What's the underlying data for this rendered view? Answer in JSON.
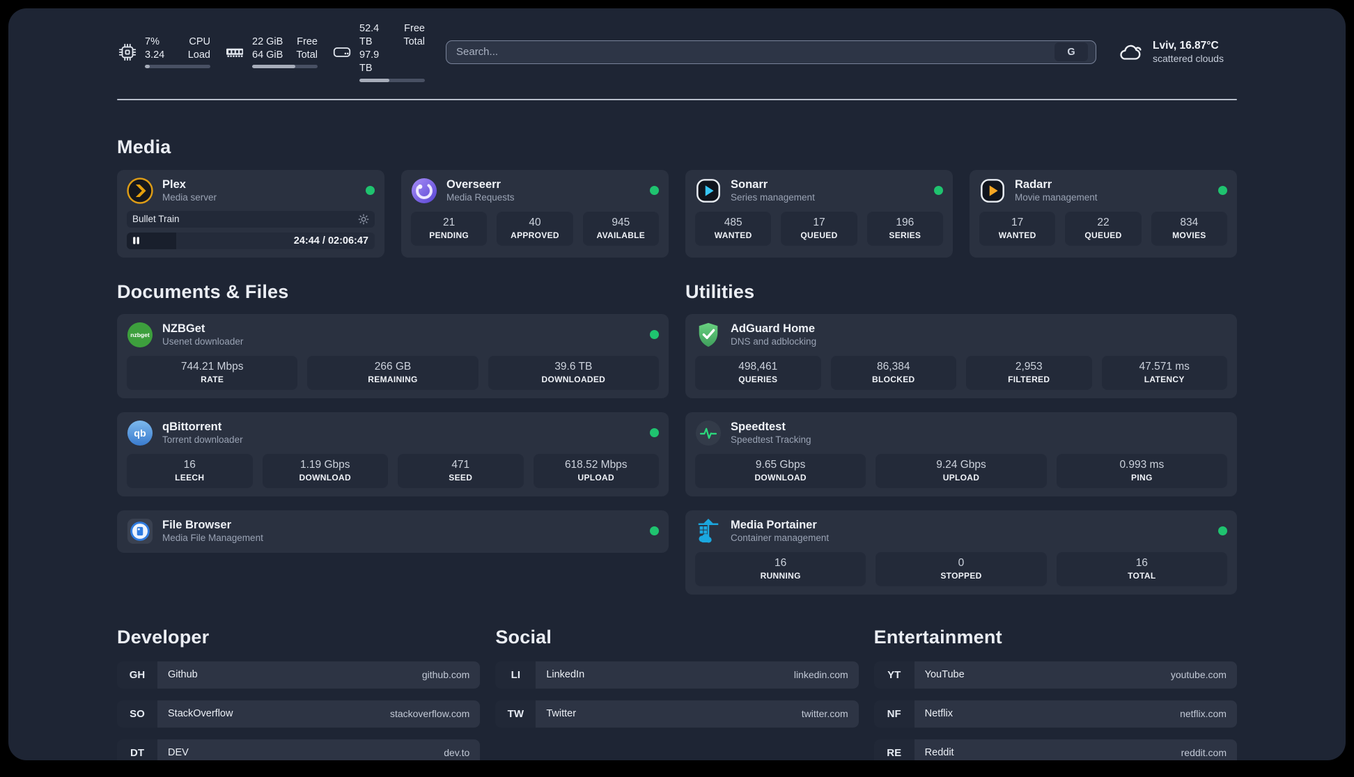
{
  "topbar": {
    "cpu": {
      "value_line1": "7%",
      "value_line2": "3.24",
      "label_line1": "CPU",
      "label_line2": "Load",
      "progress_percent": 7
    },
    "memory": {
      "value_line1": "22 GiB",
      "value_line2": "64 GiB",
      "label_line1": "Free",
      "label_line2": "Total",
      "progress_percent": 66
    },
    "disk": {
      "value_line1": "52.4 TB",
      "value_line2": "97.9 TB",
      "label_line1": "Free",
      "label_line2": "Total",
      "progress_percent": 46
    },
    "search": {
      "placeholder": "Search...",
      "key_label": "G"
    },
    "weather": {
      "location_temp": "Lviv, 16.87°C",
      "condition": "scattered clouds"
    }
  },
  "media": {
    "title": "Media",
    "plex": {
      "title": "Plex",
      "subtitle": "Media server",
      "now_playing": "Bullet Train",
      "time": "24:44 / 02:06:47",
      "progress_percent": 20
    },
    "overseerr": {
      "title": "Overseerr",
      "subtitle": "Media Requests",
      "stats": [
        {
          "value": "21",
          "label": "PENDING"
        },
        {
          "value": "40",
          "label": "APPROVED"
        },
        {
          "value": "945",
          "label": "AVAILABLE"
        }
      ]
    },
    "sonarr": {
      "title": "Sonarr",
      "subtitle": "Series management",
      "stats": [
        {
          "value": "485",
          "label": "WANTED"
        },
        {
          "value": "17",
          "label": "QUEUED"
        },
        {
          "value": "196",
          "label": "SERIES"
        }
      ]
    },
    "radarr": {
      "title": "Radarr",
      "subtitle": "Movie management",
      "stats": [
        {
          "value": "17",
          "label": "WANTED"
        },
        {
          "value": "22",
          "label": "QUEUED"
        },
        {
          "value": "834",
          "label": "MOVIES"
        }
      ]
    }
  },
  "documents": {
    "title": "Documents & Files",
    "nzbget": {
      "title": "NZBGet",
      "subtitle": "Usenet downloader",
      "stats": [
        {
          "value": "744.21 Mbps",
          "label": "RATE"
        },
        {
          "value": "266 GB",
          "label": "REMAINING"
        },
        {
          "value": "39.6 TB",
          "label": "DOWNLOADED"
        }
      ]
    },
    "qbittorrent": {
      "title": "qBittorrent",
      "subtitle": "Torrent downloader",
      "stats": [
        {
          "value": "16",
          "label": "LEECH"
        },
        {
          "value": "1.19 Gbps",
          "label": "DOWNLOAD"
        },
        {
          "value": "471",
          "label": "SEED"
        },
        {
          "value": "618.52 Mbps",
          "label": "UPLOAD"
        }
      ]
    },
    "filebrowser": {
      "title": "File Browser",
      "subtitle": "Media File Management"
    }
  },
  "utilities": {
    "title": "Utilities",
    "adguard": {
      "title": "AdGuard Home",
      "subtitle": "DNS and adblocking",
      "stats": [
        {
          "value": "498,461",
          "label": "QUERIES"
        },
        {
          "value": "86,384",
          "label": "BLOCKED"
        },
        {
          "value": "2,953",
          "label": "FILTERED"
        },
        {
          "value": "47.571 ms",
          "label": "LATENCY"
        }
      ]
    },
    "speedtest": {
      "title": "Speedtest",
      "subtitle": "Speedtest Tracking",
      "stats": [
        {
          "value": "9.65 Gbps",
          "label": "DOWNLOAD"
        },
        {
          "value": "9.24 Gbps",
          "label": "UPLOAD"
        },
        {
          "value": "0.993 ms",
          "label": "PING"
        }
      ]
    },
    "portainer": {
      "title": "Media Portainer",
      "subtitle": "Container management",
      "stats": [
        {
          "value": "16",
          "label": "RUNNING"
        },
        {
          "value": "0",
          "label": "STOPPED"
        },
        {
          "value": "16",
          "label": "TOTAL"
        }
      ]
    }
  },
  "links": {
    "developer": {
      "title": "Developer",
      "items": [
        {
          "abbr": "GH",
          "name": "Github",
          "url": "github.com"
        },
        {
          "abbr": "SO",
          "name": "StackOverflow",
          "url": "stackoverflow.com"
        },
        {
          "abbr": "DT",
          "name": "DEV",
          "url": "dev.to"
        }
      ]
    },
    "social": {
      "title": "Social",
      "items": [
        {
          "abbr": "LI",
          "name": "LinkedIn",
          "url": "linkedin.com"
        },
        {
          "abbr": "TW",
          "name": "Twitter",
          "url": "twitter.com"
        }
      ]
    },
    "entertainment": {
      "title": "Entertainment",
      "items": [
        {
          "abbr": "YT",
          "name": "YouTube",
          "url": "youtube.com"
        },
        {
          "abbr": "NF",
          "name": "Netflix",
          "url": "netflix.com"
        },
        {
          "abbr": "RE",
          "name": "Reddit",
          "url": "reddit.com"
        }
      ]
    }
  },
  "colors": {
    "status_online": "#1fc36f",
    "page_background": "#1e2534",
    "card_background": "#2a3140",
    "plex_accent": "#e5a00d",
    "sonarr_accent": "#38c6f4",
    "radarr_accent": "#f5a623",
    "adguard_accent": "#57c46d",
    "speedtest_accent": "#2bd97c",
    "portainer_accent": "#1ba8e0"
  }
}
